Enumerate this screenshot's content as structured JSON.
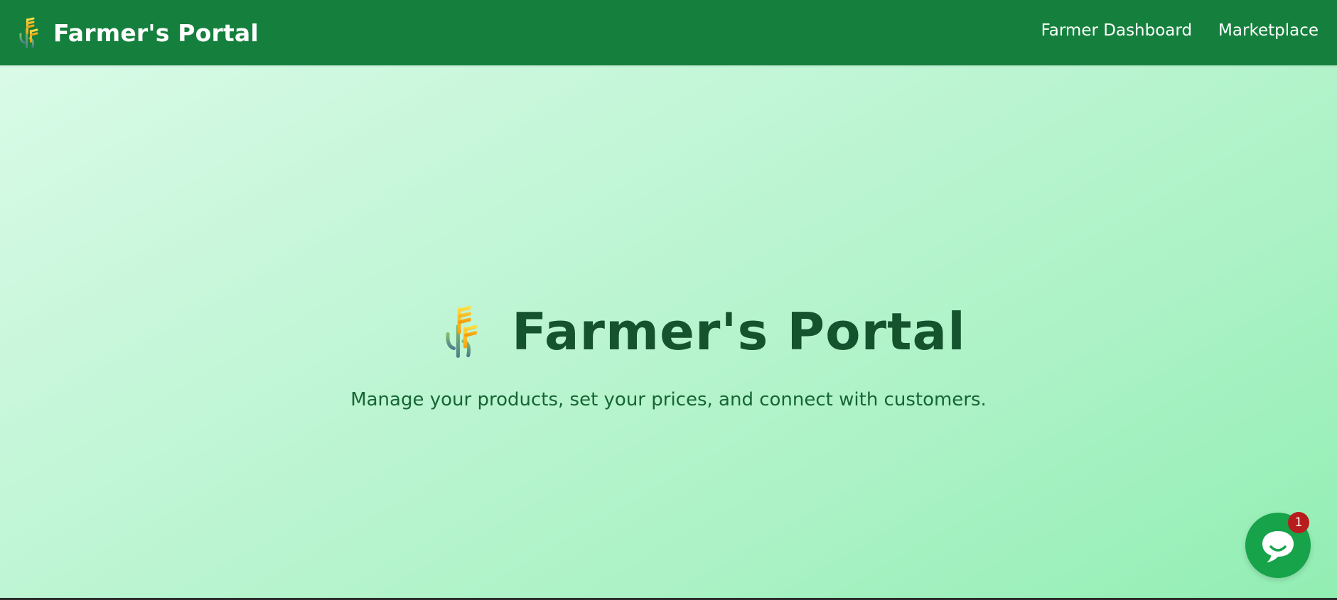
{
  "header": {
    "brand_title": "Farmer's Portal",
    "logo_icon": "wheat-icon",
    "nav": [
      {
        "label": "Farmer Dashboard"
      },
      {
        "label": "Marketplace"
      }
    ]
  },
  "hero": {
    "title": "Farmer's Portal",
    "subtitle": "Manage your products, set your prices, and connect with customers.",
    "logo_icon": "wheat-icon"
  },
  "chat_widget": {
    "icon": "chat-bubble-icon",
    "badge_count": "1"
  },
  "colors": {
    "navbar": "#15803d",
    "hero_title": "#14532d",
    "hero_subtitle": "#166534",
    "chat_button": "#16a34a",
    "badge": "#b91c1c"
  }
}
